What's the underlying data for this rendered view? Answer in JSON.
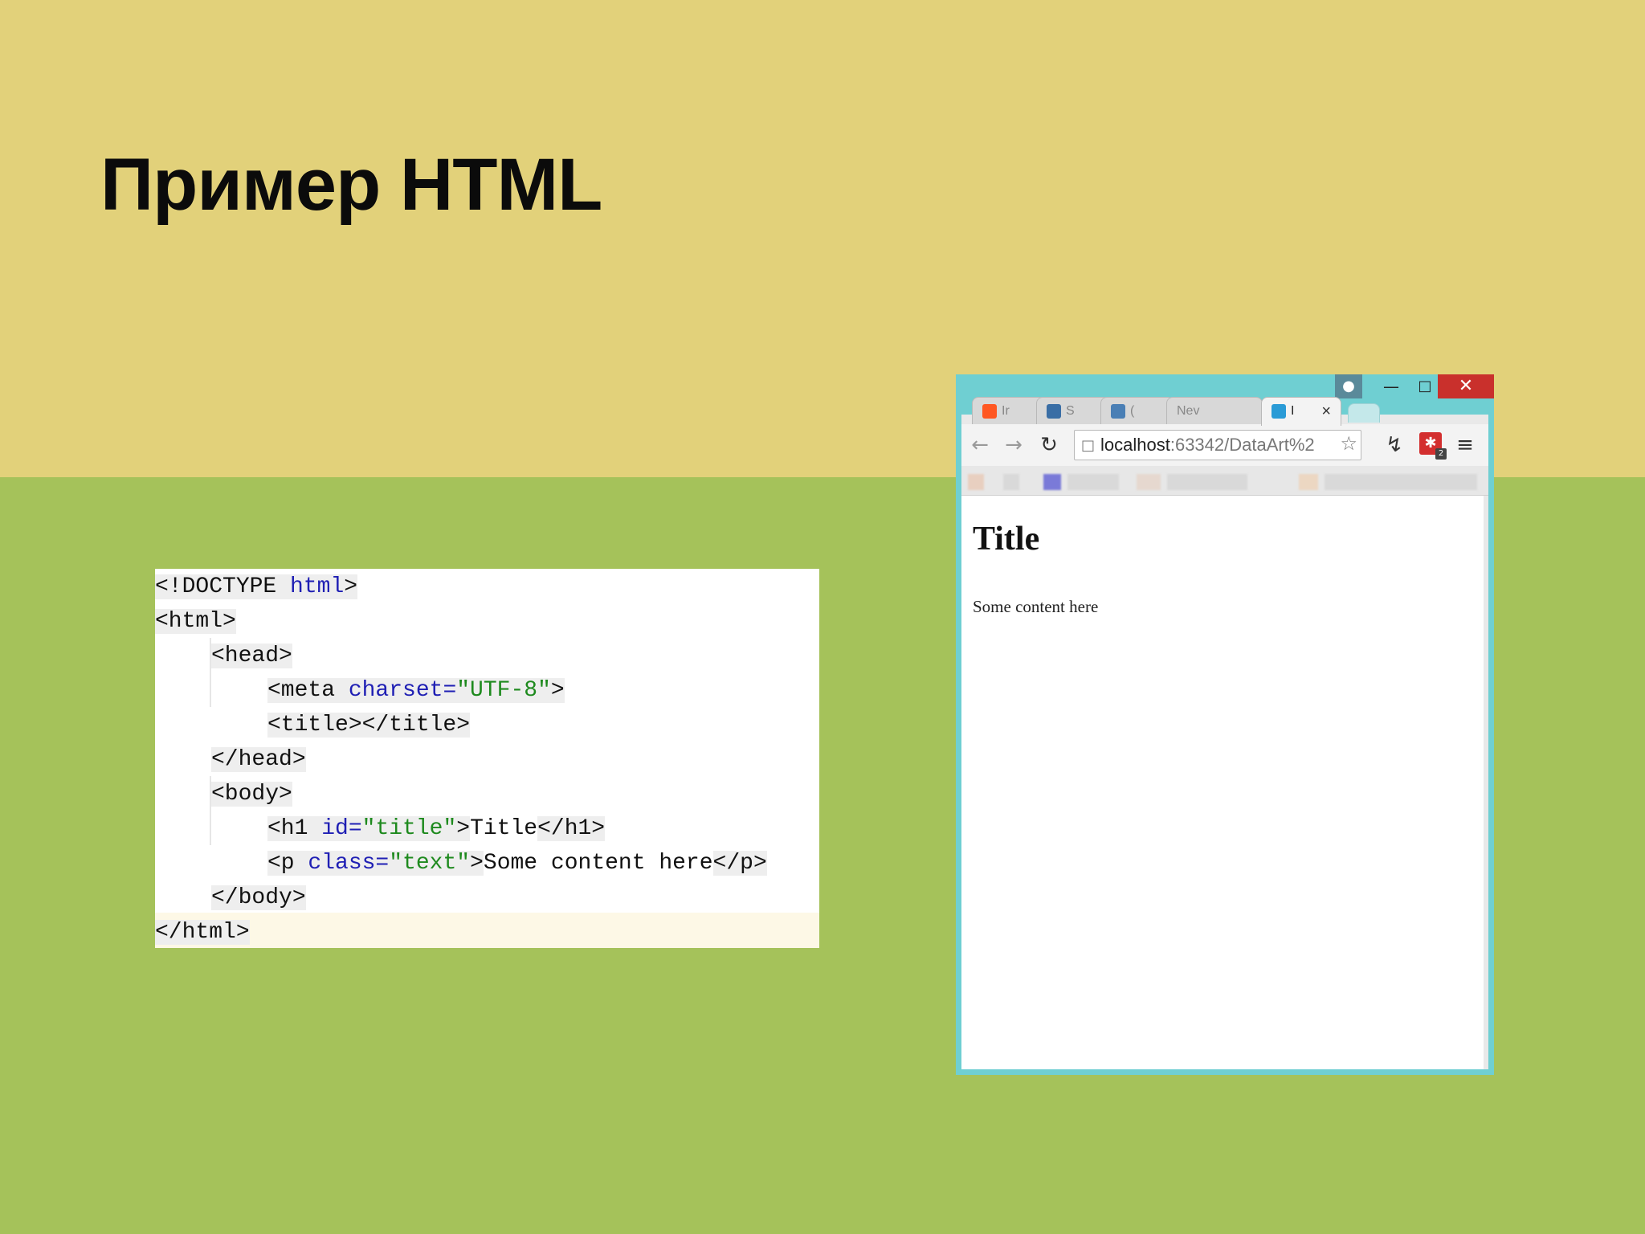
{
  "slide": {
    "title": "Пример HTML"
  },
  "code": {
    "lines": [
      [
        {
          "t": "<!DOCTYPE ",
          "c": "tg"
        },
        {
          "t": "html",
          "c": "kw tg"
        },
        {
          "t": ">",
          "c": "tg"
        }
      ],
      [
        {
          "t": "<html>",
          "c": "tg"
        }
      ],
      [
        {
          "t": "<head>",
          "c": "tg"
        }
      ],
      [
        {
          "t": "<meta ",
          "c": "tg"
        },
        {
          "t": "charset=",
          "c": "at tg"
        },
        {
          "t": "\"UTF-8\"",
          "c": "st tg"
        },
        {
          "t": ">",
          "c": "tg"
        }
      ],
      [
        {
          "t": "<title></title>",
          "c": "tg"
        }
      ],
      [
        {
          "t": "</head>",
          "c": "tg"
        }
      ],
      [
        {
          "t": "<body>",
          "c": "tg"
        }
      ],
      [
        {
          "t": "<h1 ",
          "c": "tg"
        },
        {
          "t": "id=",
          "c": "at tg"
        },
        {
          "t": "\"title\"",
          "c": "st tg"
        },
        {
          "t": ">",
          "c": "tg"
        },
        {
          "t": "Title",
          "c": ""
        },
        {
          "t": "</h1>",
          "c": "tg"
        }
      ],
      [
        {
          "t": "<p ",
          "c": "tg"
        },
        {
          "t": "class=",
          "c": "at tg"
        },
        {
          "t": "\"text\"",
          "c": "st tg"
        },
        {
          "t": ">",
          "c": "tg"
        },
        {
          "t": "Some content here",
          "c": ""
        },
        {
          "t": "</p>",
          "c": "tg"
        }
      ],
      [
        {
          "t": "</body>",
          "c": "tg"
        }
      ],
      [
        {
          "t": "</html>",
          "c": "tg"
        }
      ]
    ]
  },
  "browser": {
    "tabs": [
      {
        "label": "Ir",
        "favicon_color": "#ff5722",
        "active": false
      },
      {
        "label": "S",
        "favicon_color": "#3a6ea5",
        "active": false
      },
      {
        "label": "(",
        "favicon_color": "#4a7fb5",
        "active": false
      },
      {
        "label": "Nev",
        "favicon_color": "",
        "active": false
      },
      {
        "label": "I",
        "favicon_color": "#2a9bd6",
        "active": true
      }
    ],
    "tab_close_glyph": "×",
    "url_host": "localhost",
    "url_path": ":63342/DataArt%2",
    "extension_badge_count": "2",
    "page": {
      "heading": "Title",
      "paragraph": "Some content here"
    }
  },
  "colors": {
    "slide_top": "#e2d17a",
    "slide_bottom": "#a5c25a",
    "window_frame": "#6fcfd2",
    "close_button": "#c9302c"
  }
}
